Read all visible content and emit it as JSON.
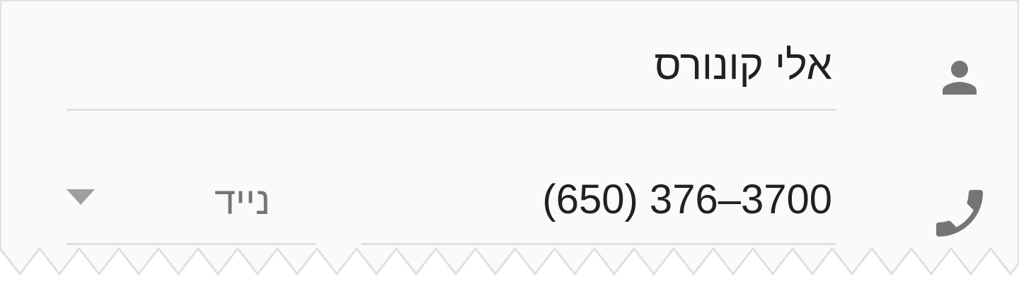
{
  "contact": {
    "name": "אלי קונורס",
    "phone": "(650) 376–3700",
    "phone_type": "נייד"
  },
  "icons": {
    "name": "person-icon",
    "phone": "phone-icon",
    "dropdown": "dropdown-arrow-icon"
  },
  "colors": {
    "background": "#fafafa",
    "text_primary": "#212121",
    "text_secondary": "#757575",
    "divider": "#e0e0e0"
  }
}
